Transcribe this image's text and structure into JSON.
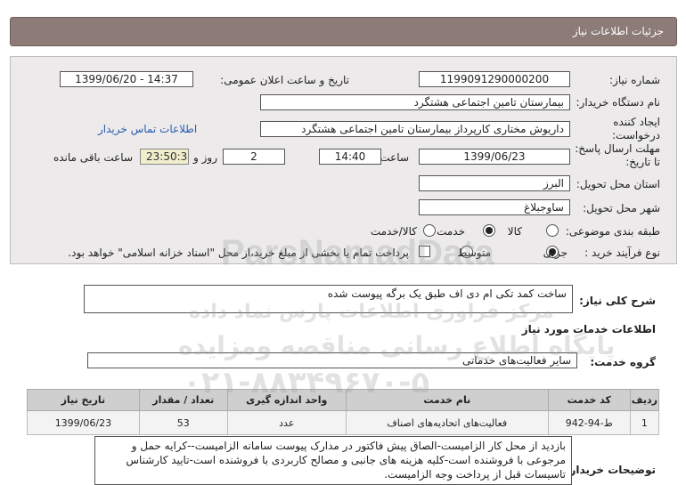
{
  "header": {
    "title": "جزئیات اطلاعات نیاز"
  },
  "form": {
    "need_number_label": "شماره نیاز:",
    "need_number": "1199091290000200",
    "announce_label": "تاریخ و ساعت اعلان عمومی:",
    "announce_value": "1399/06/20 - 14:37",
    "buyer_label": "نام دستگاه خریدار:",
    "buyer_value": "بیمارستان تامین اجتماعی هشتگرد",
    "creator_label_1": "ایجاد کننده",
    "creator_label_2": "درخواست:",
    "creator_value": "داریوش مختاری کارپرداز بیمارستان تامین اجتماعی هشتگرد",
    "contact_link": "اطلاعات تماس خریدار",
    "deadline_label_1": "مهلت ارسال پاسخ:",
    "deadline_label_2": "تا تاریخ:",
    "deadline_date": "1399/06/23",
    "time_label": "ساعت",
    "deadline_time": "14:40",
    "days_value": "2",
    "days_label": "روز و",
    "remaining_value": "23:50:37",
    "remaining_label": "ساعت باقی مانده",
    "province_label": "استان محل تحویل:",
    "province_value": "البرز",
    "city_label": "شهر محل تحویل:",
    "city_value": "ساوجبلاغ",
    "category_label": "طبقه بندی موضوعی:",
    "category_options": [
      "کالا",
      "خدمت",
      "کالا/خدمت"
    ],
    "category_selected": "خدمت",
    "process_label": "نوع فرآیند خرید :",
    "process_options": [
      "جزیی",
      "متوسط"
    ],
    "process_selected": "جزیی",
    "payment_note": "پرداخت تمام یا بخشی از مبلغ خرید،از محل \"اسناد خزانه اسلامی\" خواهد بود."
  },
  "summary": {
    "label": "شرح کلی نیاز:",
    "value": "ساخت کمد تکی ام دی اف طبق یک برگه پیوست شده"
  },
  "services_title": "اطلاعات خدمات مورد نیاز",
  "service_group": {
    "label": "گروه خدمت:",
    "value": "سایر فعالیت‌های خدماتی"
  },
  "table": {
    "headers": [
      "ردیف",
      "کد خدمت",
      "نام خدمت",
      "واحد اندازه گیری",
      "تعداد / مقدار",
      "تاریخ نیاز"
    ],
    "rows": [
      [
        "1",
        "ط-94-942",
        "فعالیت‌های اتحادیه‌های اصناف",
        "عدد",
        "53",
        "1399/06/23"
      ]
    ]
  },
  "buyer_notes": {
    "label": "توضیحات خریدار:",
    "value": "بازدید از محل کار الزامیست-الصاق پیش فاکتور در مدارک پیوست سامانه الزامیست--کرایه حمل و مرجوعی با فروشنده است-کلیه هزینه های جانبی و مصالح کاربردی با فروشنده است-تایید کارشناس تاسیسات قبل از پرداخت وجه الزامیست."
  },
  "watermark": {
    "brand": "ParsNamadData",
    "line1": "مرکز فراوری اطلاعات پارس نماد داده",
    "line2": "پایگاه اطلاع رسانی مناقصه ومزایده",
    "phone": "۰۲۱-۸۸۳۴۹۶۷۰-۵"
  }
}
